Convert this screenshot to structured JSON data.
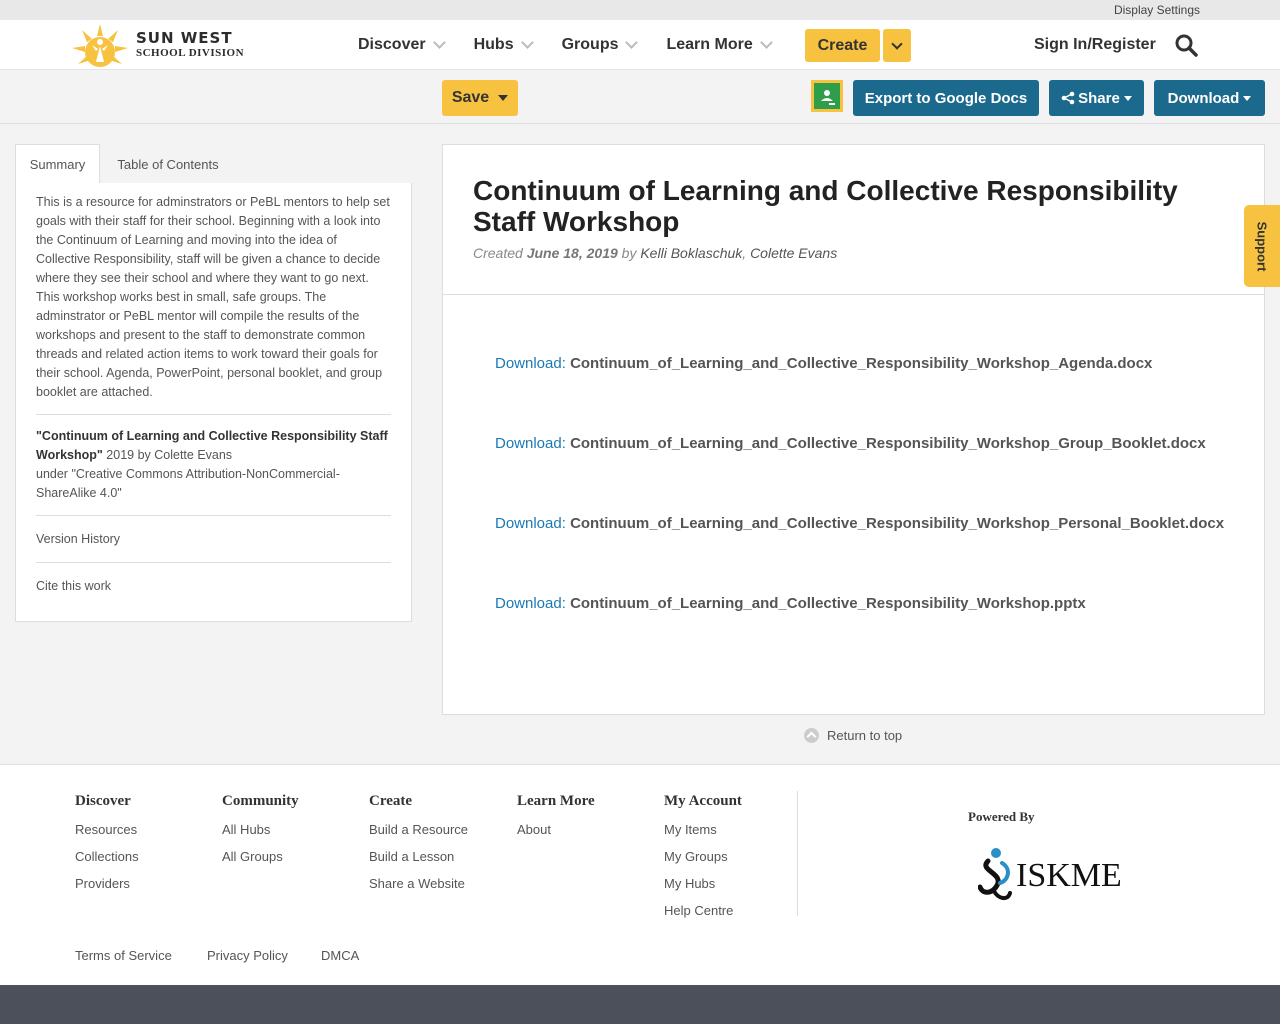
{
  "utility": {
    "display_settings": "Display Settings"
  },
  "logo": {
    "line1": "SUN WEST",
    "line2": "SCHOOL DIVISION"
  },
  "nav": {
    "items": [
      {
        "label": "Discover"
      },
      {
        "label": "Hubs"
      },
      {
        "label": "Groups"
      },
      {
        "label": "Learn More"
      }
    ],
    "create": "Create",
    "signin": "Sign In/Register"
  },
  "actions": {
    "save": "Save",
    "export": "Export to Google Docs",
    "share": "Share",
    "download": "Download"
  },
  "sidebar": {
    "tabs": [
      "Summary",
      "Table of Contents"
    ],
    "summary": "This is a resource for adminstrators or PeBL mentors to help set goals with their staff for their school. Beginning with a look into the Continuum of Learning and moving into the idea of Collective Responsibility, staff will be given a chance to decide where they see their school and where they want to go next. This workshop works best in small, safe groups. The adminstrator or PeBL mentor will compile the results of the workshops and present to the staff to demonstrate common threads and related action items to work toward their goals for their school. Agenda, PowerPoint, personal booklet, and group booklet are attached.",
    "citation_title": "\"Continuum of Learning and Collective Responsibility Staff Workshop\"",
    "citation_rest": " 2019 by Colette Evans",
    "citation_license": "under \"Creative Commons Attribution-NonCommercial-ShareAlike 4.0\"",
    "version_history": "Version History",
    "cite": "Cite this work"
  },
  "resource": {
    "title": "Continuum of Learning and Collective Responsibility Staff Workshop",
    "created_label": "Created",
    "date": "June 18, 2019",
    "by": "by",
    "author1": "Kelli Boklaschuk",
    "author_sep": ", ",
    "author2": "Colette Evans",
    "download_label": "Download:",
    "files": [
      "Continuum_of_Learning_and_Collective_Responsibility_Workshop_Agenda.docx",
      "Continuum_of_Learning_and_Collective_Responsibility_Workshop_Group_Booklet.docx",
      "Continuum_of_Learning_and_Collective_Responsibility_Workshop_Personal_Booklet.docx",
      "Continuum_of_Learning_and_Collective_Responsibility_Workshop.pptx"
    ]
  },
  "support": "Support",
  "return_top": "Return to top",
  "footer": {
    "discover": {
      "title": "Discover",
      "links": [
        "Resources",
        "Collections",
        "Providers"
      ]
    },
    "community": {
      "title": "Community",
      "links": [
        "All Hubs",
        "All Groups"
      ]
    },
    "create": {
      "title": "Create",
      "links": [
        "Build a Resource",
        "Build a Lesson",
        "Share a Website"
      ]
    },
    "learn": {
      "title": "Learn More",
      "links": [
        "About"
      ]
    },
    "account": {
      "title": "My Account",
      "links": [
        "My Items",
        "My Groups",
        "My Hubs",
        "Help Centre"
      ]
    },
    "powered_by": "Powered By",
    "iskme": "ISKME",
    "legal": [
      "Terms of Service",
      "Privacy Policy",
      "DMCA"
    ]
  },
  "colors": {
    "accent_yellow": "#f7c23f",
    "button_blue": "#1b6a8d",
    "link_blue": "#1b7ab5"
  }
}
